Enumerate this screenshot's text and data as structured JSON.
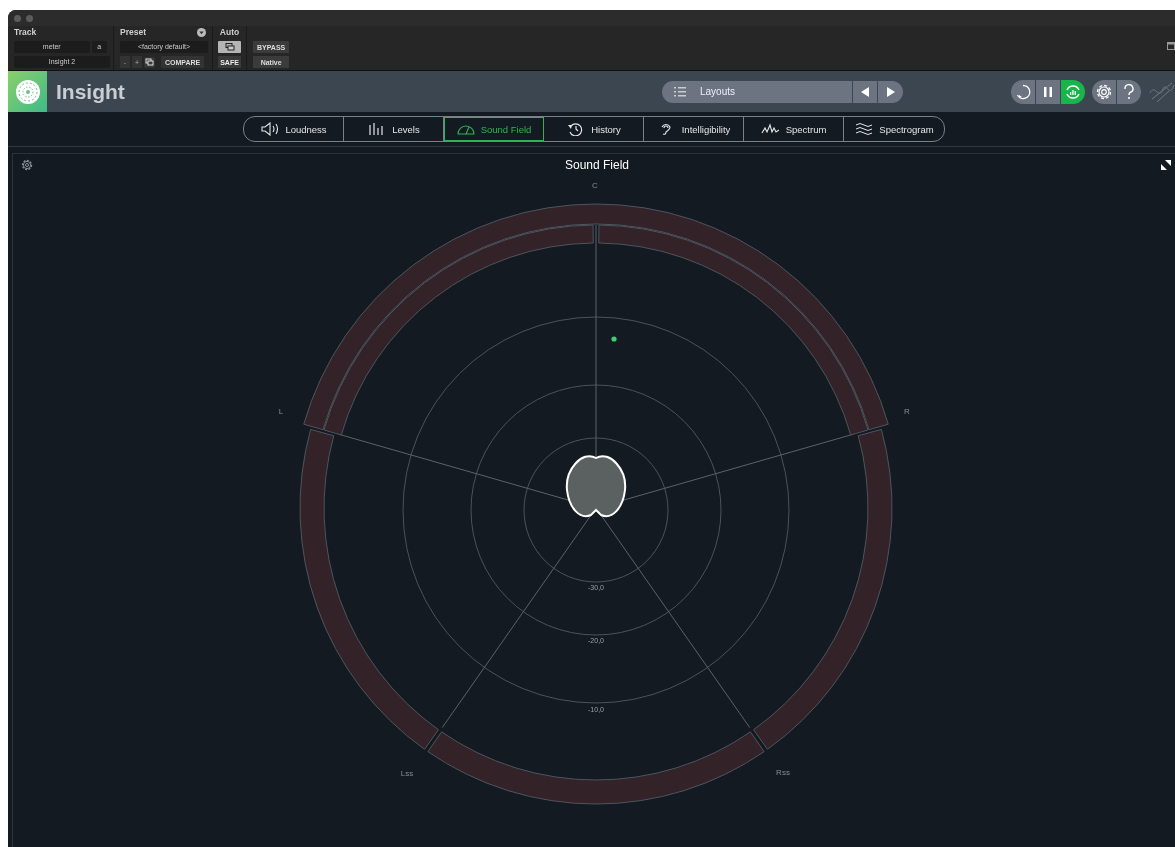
{
  "host_header": {
    "track": {
      "label": "Track",
      "track_name": "meter",
      "track_letter": "a",
      "insert": "Insight 2"
    },
    "preset": {
      "label": "Preset",
      "name": "<factory default>",
      "minus": "-",
      "plus": "+",
      "compare": "COMPARE"
    },
    "auto": {
      "label": "Auto",
      "safe": "SAFE"
    },
    "bypass": "BYPASS",
    "native": "Native"
  },
  "plugin_header": {
    "title": "Insight",
    "layouts": "Layouts",
    "transport": [
      {
        "kind": "reset",
        "on": false
      },
      {
        "kind": "pause",
        "on": false
      },
      {
        "kind": "sync",
        "on": true
      }
    ]
  },
  "tabs": [
    {
      "label": "Loudness",
      "selected": false
    },
    {
      "label": "Levels",
      "selected": false
    },
    {
      "label": "Sound Field",
      "selected": true
    },
    {
      "label": "History",
      "selected": false
    },
    {
      "label": "Intelligibility",
      "selected": false
    },
    {
      "label": "Spectrum",
      "selected": false
    },
    {
      "label": "Spectrogram",
      "selected": false
    }
  ],
  "panel": {
    "title": "Sound Field",
    "channel_labels": [
      "C",
      "L",
      "R",
      "Lss",
      "Rss"
    ],
    "scale_labels": [
      "-30,0",
      "-20,0",
      "-10,0"
    ]
  }
}
